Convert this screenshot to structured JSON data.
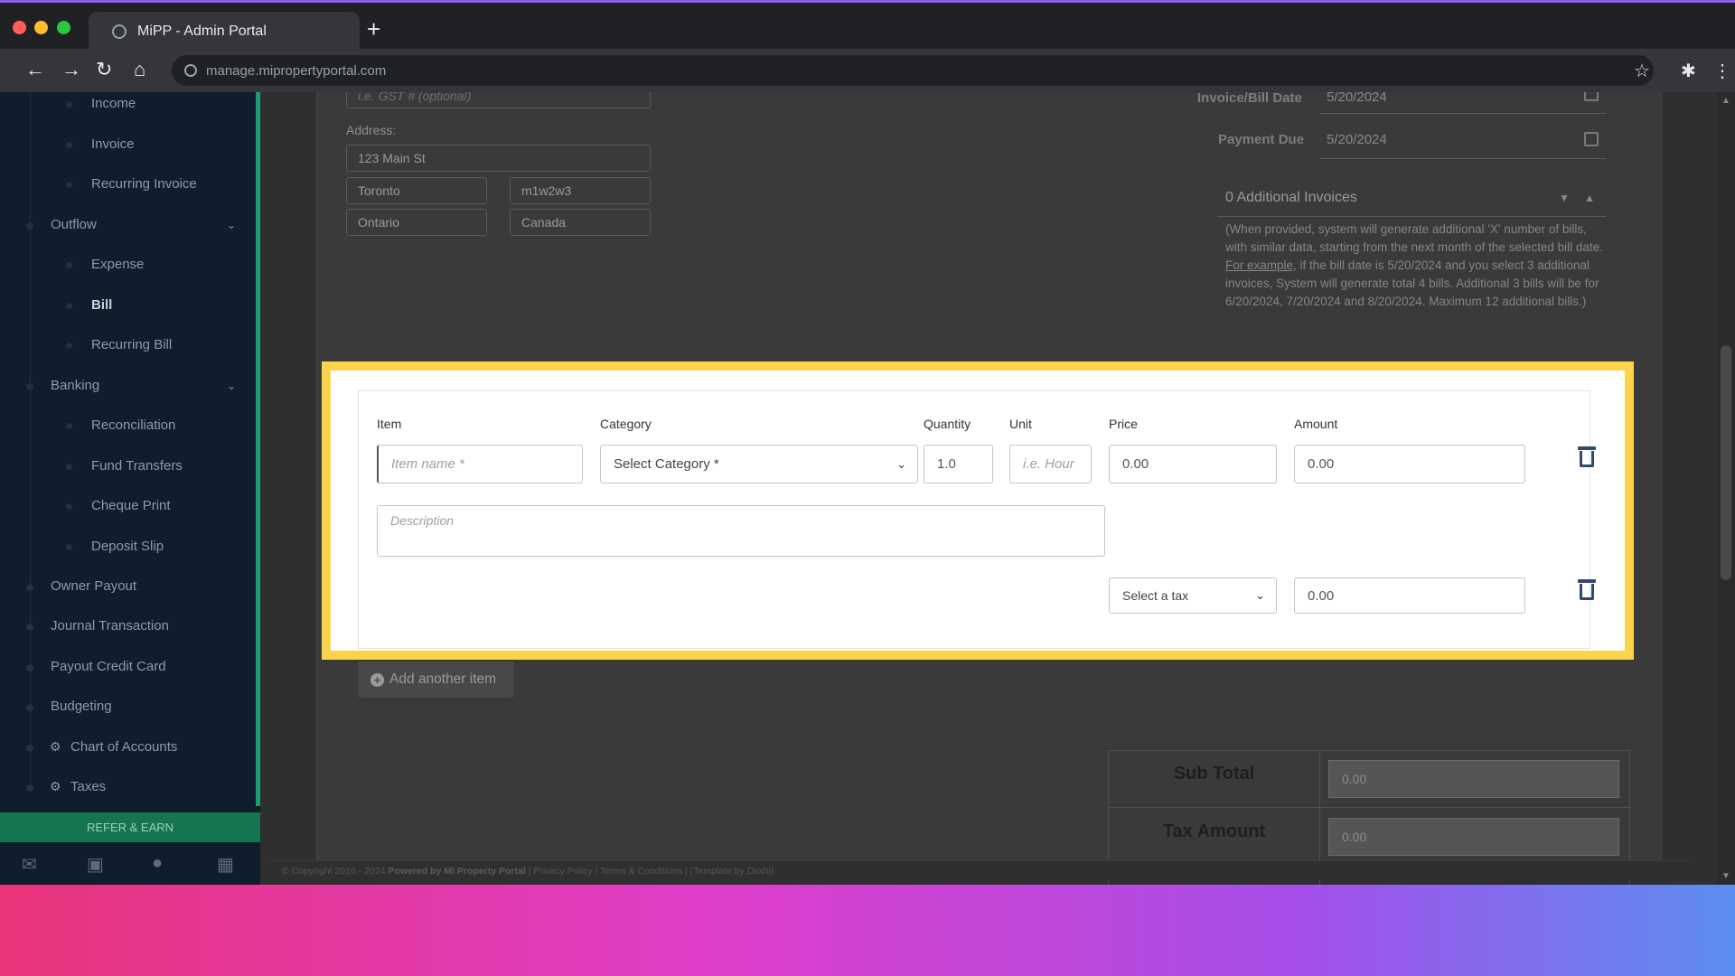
{
  "browser": {
    "tab_title": "MiPP - Admin Portal",
    "url": "manage.mipropertyportal.com"
  },
  "sidebar": {
    "items": [
      {
        "label": "Income",
        "level": "sub"
      },
      {
        "label": "Invoice",
        "level": "sub"
      },
      {
        "label": "Recurring Invoice",
        "level": "sub"
      },
      {
        "label": "Outflow",
        "level": "top",
        "chevron": true
      },
      {
        "label": "Expense",
        "level": "sub"
      },
      {
        "label": "Bill",
        "level": "sub",
        "active": true
      },
      {
        "label": "Recurring Bill",
        "level": "sub"
      },
      {
        "label": "Banking",
        "level": "top",
        "chevron": true
      },
      {
        "label": "Reconciliation",
        "level": "sub"
      },
      {
        "label": "Fund Transfers",
        "level": "sub"
      },
      {
        "label": "Cheque Print",
        "level": "sub"
      },
      {
        "label": "Deposit Slip",
        "level": "sub"
      },
      {
        "label": "Owner Payout",
        "level": "top"
      },
      {
        "label": "Journal Transaction",
        "level": "top"
      },
      {
        "label": "Payout Credit Card",
        "level": "top"
      },
      {
        "label": "Budgeting",
        "level": "top"
      },
      {
        "label": "Chart of Accounts",
        "level": "top",
        "icon": "gear-icon"
      },
      {
        "label": "Taxes",
        "level": "top",
        "icon": "gear-icon"
      }
    ],
    "refer_label": "REFER & EARN",
    "footer_icons": [
      "mail-icon",
      "briefcase-icon",
      "user-icon",
      "calculator-icon"
    ]
  },
  "vendor": {
    "gst_placeholder": "i.e. GST # (optional)",
    "address_label": "Address:",
    "street": "123 Main St",
    "city": "Toronto",
    "postal": "m1w2w3",
    "province": "Ontario",
    "country": "Canada"
  },
  "bill": {
    "date_label": "Invoice/Bill Date",
    "date_value": "5/20/2024",
    "due_label": "Payment Due",
    "due_value": "5/20/2024",
    "additional_invoices": "0 Additional Invoices",
    "note_before": "(When provided, system will generate additional 'X' number of bills, with similar data, starting from the next month of the selected bill date. ",
    "note_link": "For example",
    "note_after": ", if the bill date is 5/20/2024 and you select 3 additional invoices, System will generate total 4 bills. Additional 3 bills will be for 6/20/2024, 7/20/2024 and 8/20/2024. Maximum 12 additional bills.)"
  },
  "line_item": {
    "headers": {
      "item": "Item",
      "category": "Category",
      "quantity": "Quantity",
      "unit": "Unit",
      "price": "Price",
      "amount": "Amount"
    },
    "item_placeholder": "Item name *",
    "category_value": "Select Category *",
    "quantity_value": "1.0",
    "unit_placeholder": "i.e. Hour",
    "price_value": "0.00",
    "amount_value": "0.00",
    "description_placeholder": "Description",
    "tax_select": "Select a tax",
    "tax_amount": "0.00"
  },
  "add_item_label": "Add another item",
  "totals": {
    "subtotal_label": "Sub Total",
    "subtotal_value": "0.00",
    "tax_label": "Tax Amount",
    "tax_value": "0.00"
  },
  "footer": {
    "copyright": "© Copyright 2016 - 2024 ",
    "powered": "Powered by MI Property Portal",
    "links": " | Privacy Policy | Terms & Conditions | ",
    "theme": "(Template by Dsxhi)"
  },
  "colors": {
    "highlight": "#fcd34d",
    "sidebar_bg": "#0f1d2c",
    "refer_bg": "#16744f",
    "trash": "#2f4a6b"
  }
}
